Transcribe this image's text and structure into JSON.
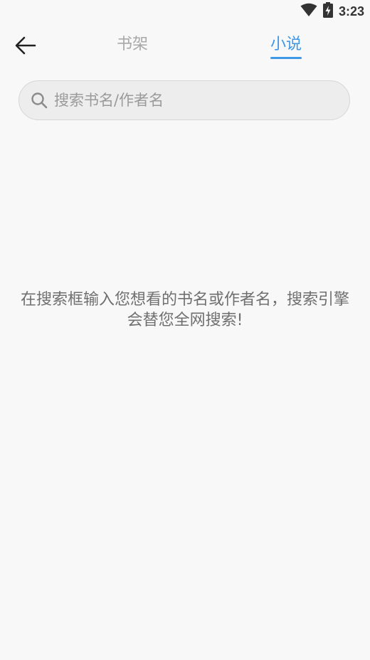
{
  "status_bar": {
    "time": "3:23",
    "icons": [
      "wifi-icon",
      "battery-charging-icon"
    ]
  },
  "header": {
    "back_icon": "arrow-left-icon",
    "tabs": [
      {
        "label": "书架",
        "active": false
      },
      {
        "label": "小说",
        "active": true
      }
    ]
  },
  "search": {
    "icon": "search-icon",
    "placeholder": "搜索书名/作者名",
    "value": ""
  },
  "empty_hint": "在搜索框输入您想看的书名或作者名，搜索引擎会替您全网搜索!",
  "colors": {
    "accent": "#3d98e8",
    "background": "#f8f8f8",
    "inactive_tab": "#a8a8a8",
    "hint_text": "#6f6f6f"
  }
}
